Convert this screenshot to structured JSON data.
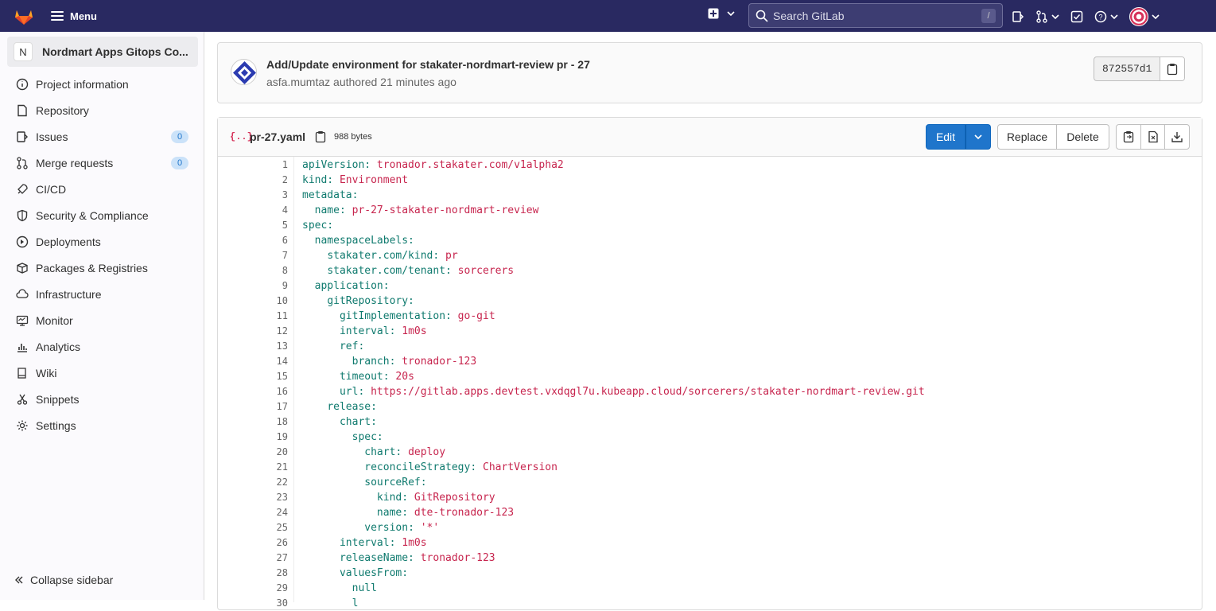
{
  "navbar": {
    "menu_label": "Menu",
    "search_placeholder": "Search GitLab",
    "search_shortcut": "/"
  },
  "sidebar": {
    "project_initial": "N",
    "project_name": "Nordmart Apps Gitops Co...",
    "items": [
      {
        "label": "Project information",
        "icon": "info-icon"
      },
      {
        "label": "Repository",
        "icon": "doc-icon"
      },
      {
        "label": "Issues",
        "icon": "issues-icon",
        "count": "0"
      },
      {
        "label": "Merge requests",
        "icon": "merge-request-icon",
        "count": "0"
      },
      {
        "label": "CI/CD",
        "icon": "rocket-icon"
      },
      {
        "label": "Security & Compliance",
        "icon": "shield-icon"
      },
      {
        "label": "Deployments",
        "icon": "deployments-icon"
      },
      {
        "label": "Packages & Registries",
        "icon": "package-icon"
      },
      {
        "label": "Infrastructure",
        "icon": "cloud-gear-icon"
      },
      {
        "label": "Monitor",
        "icon": "monitor-icon"
      },
      {
        "label": "Analytics",
        "icon": "chart-icon"
      },
      {
        "label": "Wiki",
        "icon": "book-icon"
      },
      {
        "label": "Snippets",
        "icon": "scissors-icon"
      },
      {
        "label": "Settings",
        "icon": "gear-icon"
      }
    ],
    "collapse_label": "Collapse sidebar"
  },
  "commit": {
    "title": "Add/Update environment for stakater-nordmart-review pr - 27",
    "meta": "asfa.mumtaz authored 21 minutes ago",
    "sha": "872557d1"
  },
  "file": {
    "name": "pr-27.yaml",
    "size": "988 bytes",
    "edit_label": "Edit",
    "replace_label": "Replace",
    "delete_label": "Delete"
  },
  "code_lines": [
    {
      "n": "1",
      "indent": "",
      "key": "apiVersion:",
      "val": " tronador.stakater.com/v1alpha2"
    },
    {
      "n": "2",
      "indent": "",
      "key": "kind:",
      "val": " Environment"
    },
    {
      "n": "3",
      "indent": "",
      "key": "metadata:",
      "val": ""
    },
    {
      "n": "4",
      "indent": "  ",
      "key": "name:",
      "val": " pr-27-stakater-nordmart-review"
    },
    {
      "n": "5",
      "indent": "",
      "key": "spec:",
      "val": ""
    },
    {
      "n": "6",
      "indent": "  ",
      "key": "namespaceLabels:",
      "val": ""
    },
    {
      "n": "7",
      "indent": "    ",
      "key": "stakater.com/kind:",
      "val": " pr"
    },
    {
      "n": "8",
      "indent": "    ",
      "key": "stakater.com/tenant:",
      "val": " sorcerers"
    },
    {
      "n": "9",
      "indent": "  ",
      "key": "application:",
      "val": ""
    },
    {
      "n": "10",
      "indent": "    ",
      "key": "gitRepository:",
      "val": ""
    },
    {
      "n": "11",
      "indent": "      ",
      "key": "gitImplementation:",
      "val": " go-git"
    },
    {
      "n": "12",
      "indent": "      ",
      "key": "interval:",
      "val": " 1m0s"
    },
    {
      "n": "13",
      "indent": "      ",
      "key": "ref:",
      "val": ""
    },
    {
      "n": "14",
      "indent": "        ",
      "key": "branch:",
      "val": " tronador-123"
    },
    {
      "n": "15",
      "indent": "      ",
      "key": "timeout:",
      "val": " 20s"
    },
    {
      "n": "16",
      "indent": "      ",
      "key": "url:",
      "val": " https://gitlab.apps.devtest.vxdqgl7u.kubeapp.cloud/sorcerers/stakater-nordmart-review.git"
    },
    {
      "n": "17",
      "indent": "    ",
      "key": "release:",
      "val": ""
    },
    {
      "n": "18",
      "indent": "      ",
      "key": "chart:",
      "val": ""
    },
    {
      "n": "19",
      "indent": "        ",
      "key": "spec:",
      "val": ""
    },
    {
      "n": "20",
      "indent": "          ",
      "key": "chart:",
      "val": " deploy"
    },
    {
      "n": "21",
      "indent": "          ",
      "key": "reconcileStrategy:",
      "val": " ChartVersion"
    },
    {
      "n": "22",
      "indent": "          ",
      "key": "sourceRef:",
      "val": ""
    },
    {
      "n": "23",
      "indent": "            ",
      "key": "kind:",
      "val": " GitRepository"
    },
    {
      "n": "24",
      "indent": "            ",
      "key": "name:",
      "val": " dte-tronador-123"
    },
    {
      "n": "25",
      "indent": "          ",
      "key": "version:",
      "val": " '*'"
    },
    {
      "n": "26",
      "indent": "      ",
      "key": "interval:",
      "val": " 1m0s"
    },
    {
      "n": "27",
      "indent": "      ",
      "key": "releaseName:",
      "val": " tronador-123"
    },
    {
      "n": "28",
      "indent": "      ",
      "key": "valuesFrom:",
      "val": ""
    },
    {
      "n": "29",
      "indent": "        ",
      "key": "",
      "val": "null"
    },
    {
      "n": "30",
      "indent": "        ",
      "key": "",
      "val": "l"
    }
  ]
}
